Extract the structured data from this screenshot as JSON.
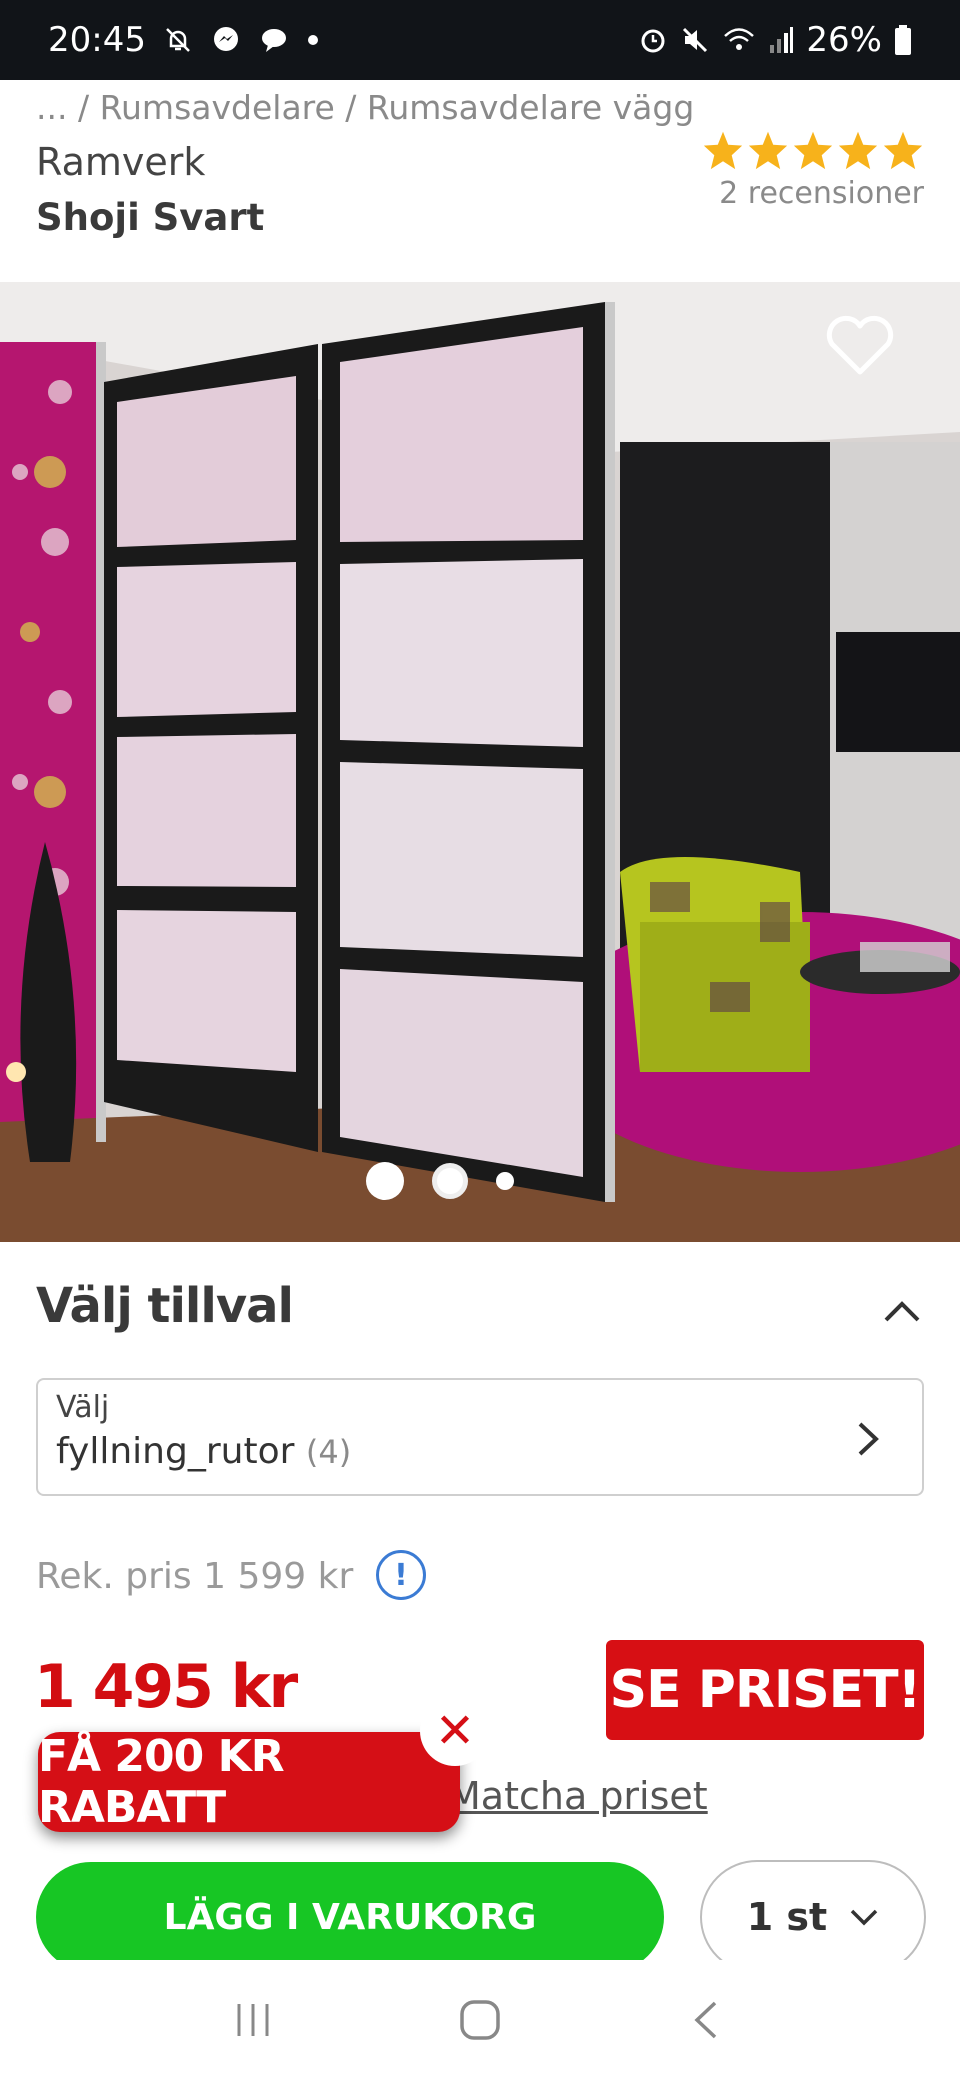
{
  "status_bar": {
    "time": "20:45",
    "battery": "26%"
  },
  "breadcrumb": "... / Rumsavdelare / Rumsavdelare vägg",
  "product": {
    "brand": "Ramverk",
    "title": "Shoji Svart",
    "rating_stars": 5,
    "reviews": "2 recensioner"
  },
  "gallery": {
    "image_count": 3,
    "active_index": 0
  },
  "options": {
    "heading": "Välj tillval",
    "select_label": "Välj",
    "select_value": "fyllning_rutor",
    "select_count": "(4)"
  },
  "pricing": {
    "rek_price": "Rek. pris 1 599 kr",
    "price": "1 495 kr",
    "see_price_label": "SE PRISET!",
    "match_price_label": "Matcha priset"
  },
  "promo": {
    "discount_label": "FÅ 200 KR RABATT",
    "close_symbol": "✕"
  },
  "cart": {
    "add_label": "LÄGG I VARUKORG",
    "quantity": "1 st"
  },
  "colors": {
    "brand_red": "#d20d11",
    "cart_green": "#17c624",
    "star_yellow": "#f7b21b",
    "info_blue": "#3b7bd4"
  },
  "icons": [
    "heart-icon",
    "chevron-up-icon",
    "chevron-right-icon",
    "info-icon",
    "close-icon",
    "chevron-down-icon",
    "nav-recents-icon",
    "nav-home-icon",
    "nav-back-icon"
  ]
}
